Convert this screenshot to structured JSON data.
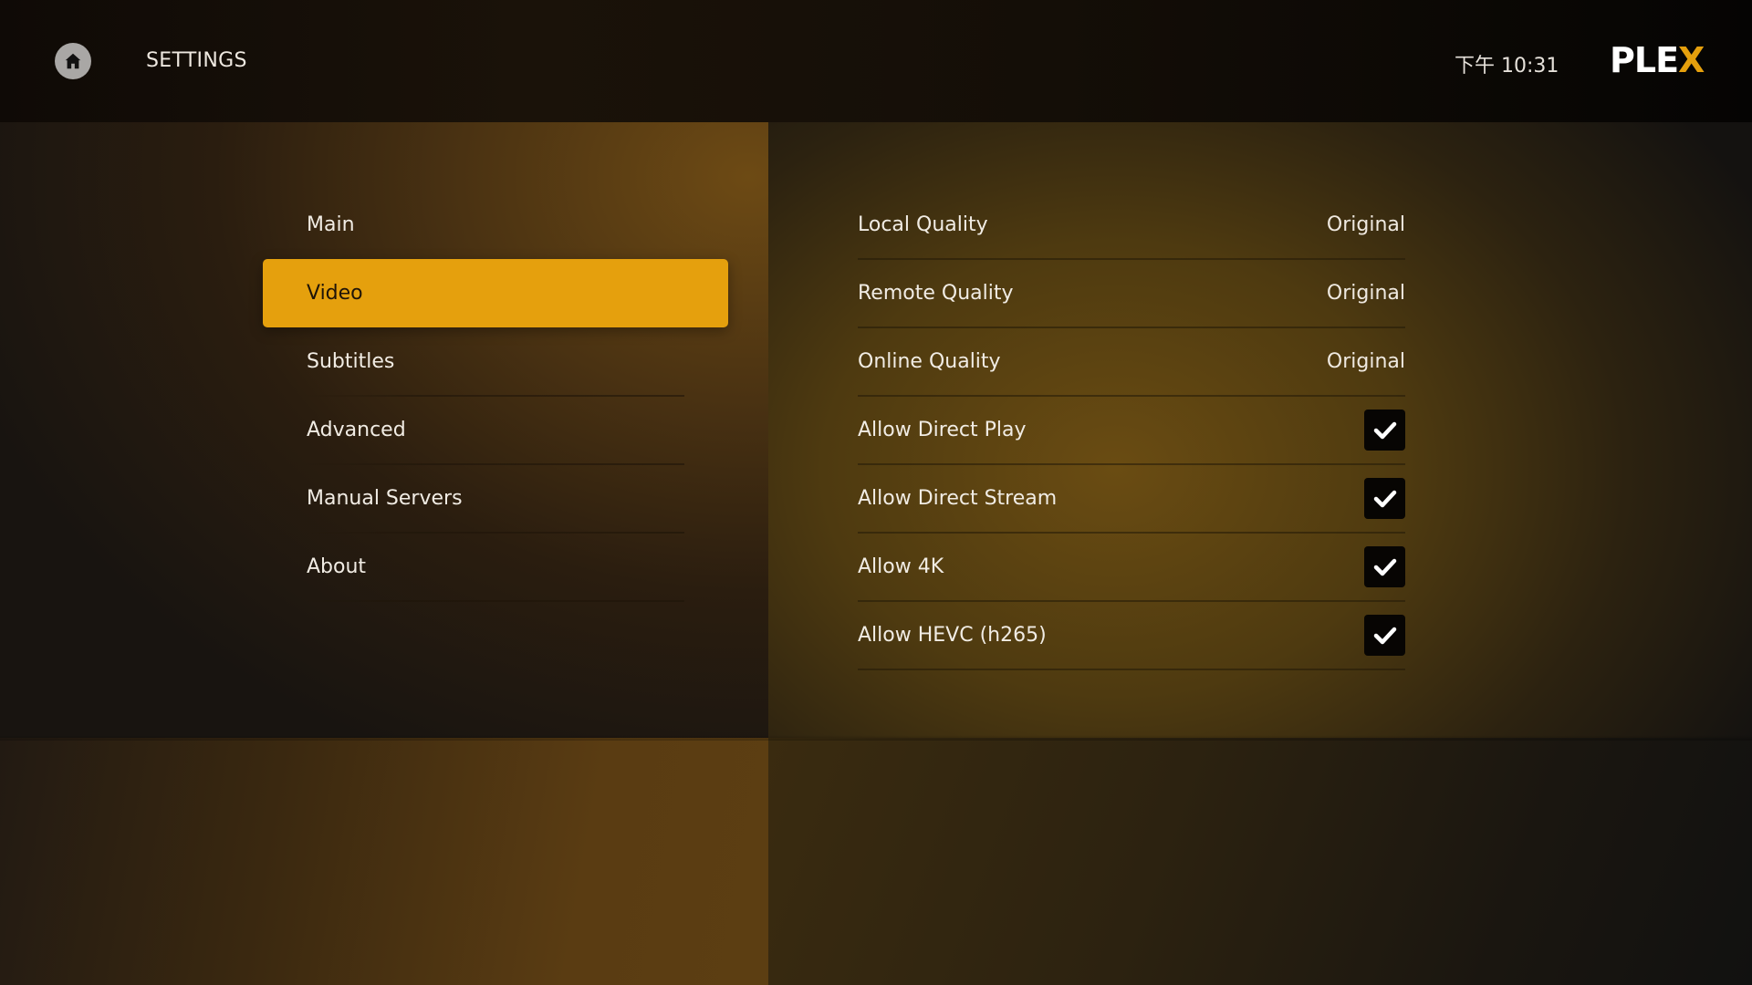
{
  "header": {
    "title": "SETTINGS",
    "home_icon": "home-icon",
    "clock": "下午 10:31",
    "logo": {
      "main": "PLE",
      "accent": "X",
      "accent_color": "#e5a00d"
    }
  },
  "menu": {
    "selected_index": 1,
    "items": [
      {
        "label": "Main"
      },
      {
        "label": "Video"
      },
      {
        "label": "Subtitles"
      },
      {
        "label": "Advanced"
      },
      {
        "label": "Manual Servers"
      },
      {
        "label": "About"
      }
    ]
  },
  "settings": {
    "rows": [
      {
        "label": "Local Quality",
        "type": "value",
        "value": "Original"
      },
      {
        "label": "Remote Quality",
        "type": "value",
        "value": "Original"
      },
      {
        "label": "Online Quality",
        "type": "value",
        "value": "Original"
      },
      {
        "label": "Allow Direct Play",
        "type": "checkbox",
        "checked": true,
        "icon": "checkmark-icon"
      },
      {
        "label": "Allow Direct Stream",
        "type": "checkbox",
        "checked": true,
        "icon": "checkmark-icon"
      },
      {
        "label": "Allow 4K",
        "type": "checkbox",
        "checked": true,
        "icon": "checkmark-icon"
      },
      {
        "label": "Allow HEVC (h265)",
        "type": "checkbox",
        "checked": true,
        "icon": "checkmark-icon"
      }
    ]
  },
  "colors": {
    "accent": "#e5a00d",
    "selected_text": "#1f1408",
    "checkbox_bg": "#070503",
    "text": "#f1ece4"
  }
}
